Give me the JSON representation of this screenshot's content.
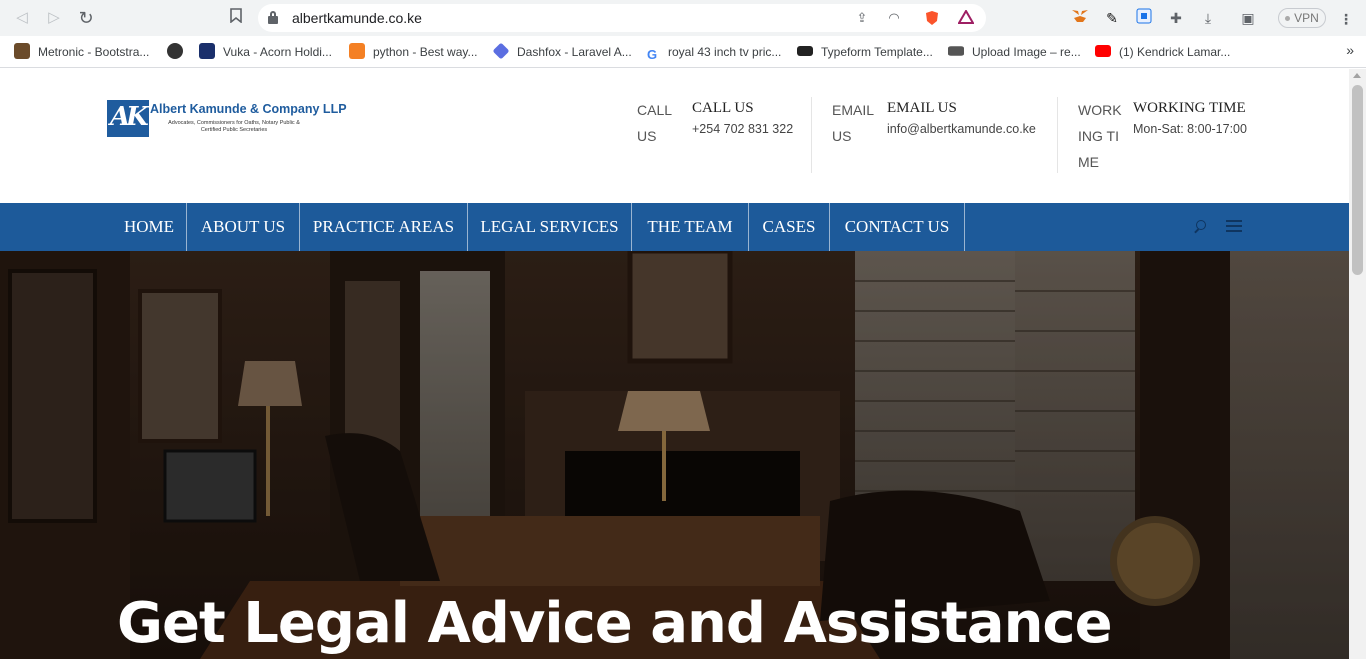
{
  "browser": {
    "url": "albertkamunde.co.ke",
    "vpn_label": "VPN",
    "bookmarks": [
      {
        "label": "Metronic - Bootstra...",
        "color": "#6b4b2a"
      },
      {
        "label": "",
        "color": "#333333"
      },
      {
        "label": "Vuka - Acorn Holdi...",
        "color": "#1a2f6b"
      },
      {
        "label": "python - Best way...",
        "color": "#f48024"
      },
      {
        "label": "Dashfox - Laravel A...",
        "color": "#5b6ee1"
      },
      {
        "label": "royal 43 inch tv pric...",
        "color": "#4285f4"
      },
      {
        "label": "Typeform Template...",
        "color": "#222222"
      },
      {
        "label": "Upload Image – re...",
        "color": "#555555"
      },
      {
        "label": "(1) Kendrick Lamar...",
        "color": "#ff0000"
      }
    ],
    "bookmarks_more": "»"
  },
  "header": {
    "logo": {
      "mark": "AK",
      "name": "Albert Kamunde & Company LLP",
      "tagline": "Advocates, Commissioners for Oaths, Notary Public & Certified Public Secretaries"
    },
    "contacts": [
      {
        "img_alt": "CALL US",
        "title": "CALL US",
        "value": "+254 702 831 322"
      },
      {
        "img_alt": "EMAIL US",
        "title": "EMAIL US",
        "value": "info@albertkamunde.co.ke"
      },
      {
        "img_alt": "WORKING TIME",
        "title": "WORKING TIME",
        "value": "Mon-Sat: 8:00-17:00"
      }
    ]
  },
  "menu": {
    "items": [
      "HOME",
      "ABOUT US",
      "PRACTICE AREAS",
      "LEGAL SERVICES",
      "THE TEAM",
      "CASES",
      "CONTACT US"
    ]
  },
  "hero": {
    "headline": "Get Legal Advice and Assistance"
  },
  "colors": {
    "brand_blue": "#1d5a9a",
    "hero_dark": "#2b1d14"
  }
}
